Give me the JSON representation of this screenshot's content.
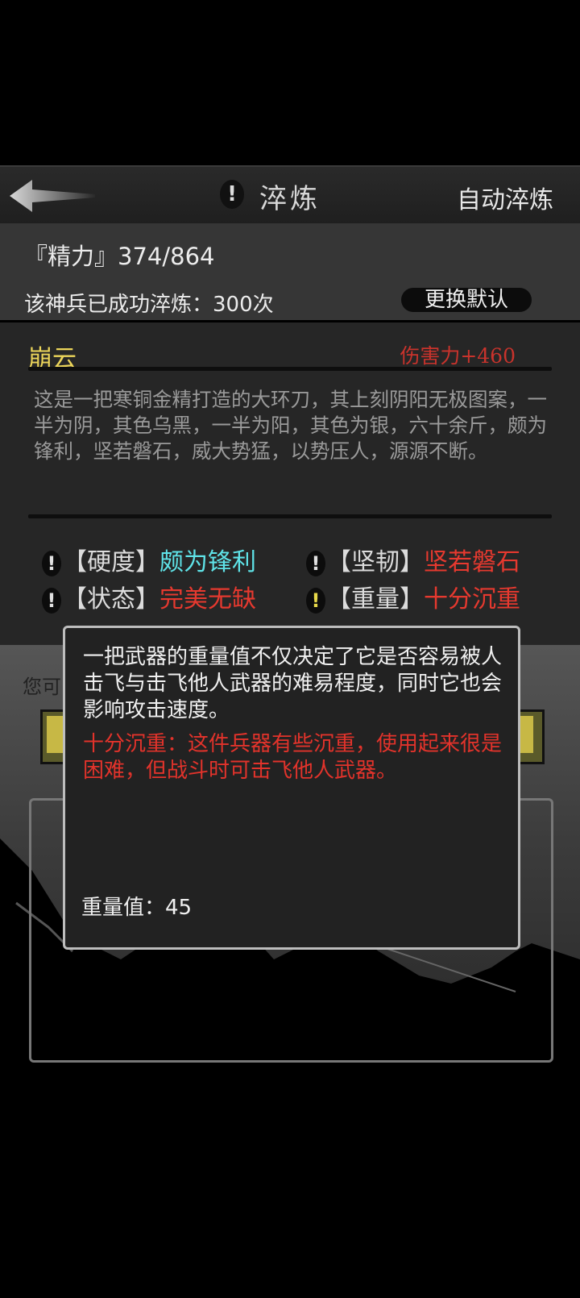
{
  "header": {
    "title": "淬炼",
    "auto_refine": "自动淬炼",
    "info_icon": "!",
    "back_icon": "back-arrow-icon"
  },
  "status": {
    "energy": "『精力』374/864",
    "refined_count": "该神兵已成功淬炼：300次",
    "change_default": "更换默认"
  },
  "weapon": {
    "name": "崩云",
    "damage": "伤害力+460",
    "description": "这是一把寒铜金精打造的大环刀，其上刻阴阳无极图案，一半为阴，其色乌黑，一半为阳，其色为银，六十余斤，颇为锋利，坚若磐石，威大势猛，以势压人，源源不断。"
  },
  "attributes": [
    {
      "label": "【硬度】",
      "value": "颇为锋利",
      "color": "#5fe3e8"
    },
    {
      "label": "【坚韧】",
      "value": "坚若磐石",
      "color": "#e6392f"
    },
    {
      "label": "【状态】",
      "value": "完美无缺",
      "color": "#e6392f"
    },
    {
      "label": "【重量】",
      "value": "十分沉重",
      "color": "#e6392f"
    }
  ],
  "background": {
    "partial_text": "您可"
  },
  "tooltip": {
    "description": "一把武器的重量值不仅决定了它是否容易被人击飞与击飞他人武器的难易程度，同时它也会影响攻击速度。",
    "detail": "十分沉重：这件兵器有些沉重，使用起来很是困难，但战斗时可击飞他人武器。",
    "weight_value": "重量值：45"
  },
  "colors": {
    "accent_yellow": "#ecd55a",
    "damage_red": "#c9332c",
    "cyan": "#5fe3e8",
    "red": "#e6392f"
  }
}
